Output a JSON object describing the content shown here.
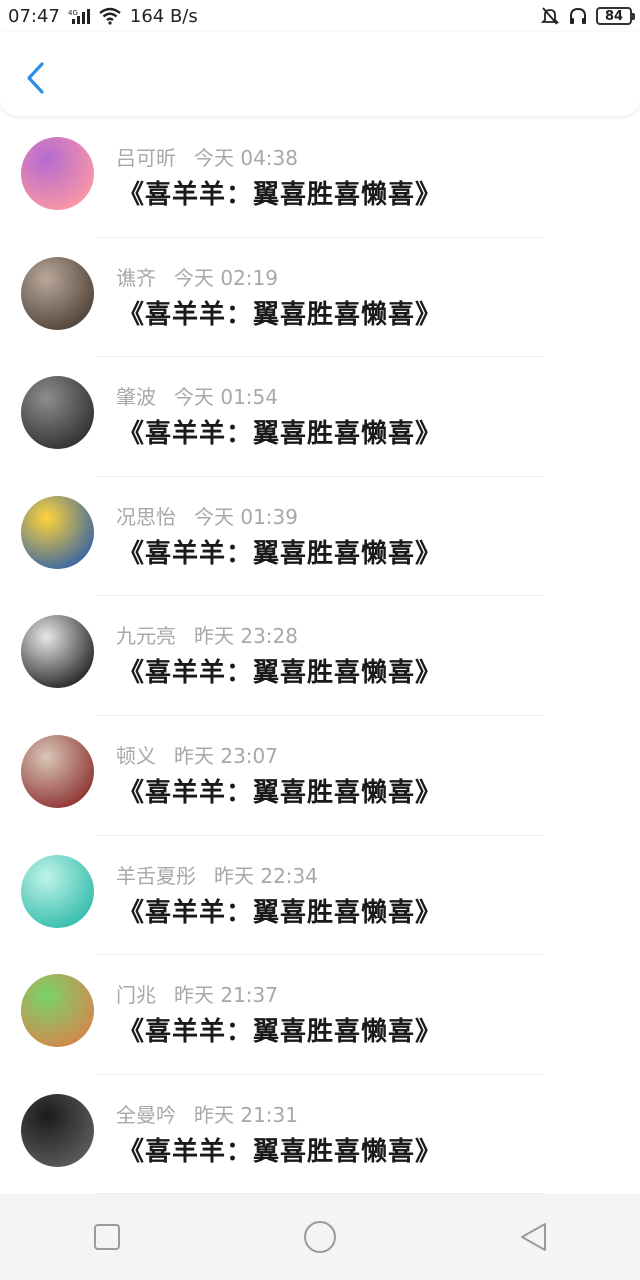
{
  "status_bar": {
    "time": "07:47",
    "network": "4G",
    "speed": "164 B/s",
    "battery": "84"
  },
  "header": {
    "back_icon": "chevron-left-icon"
  },
  "messages": [
    {
      "name": "吕可昕",
      "time": "今天 04:38",
      "text": "《喜羊羊：翼喜胜喜懒喜》",
      "avatar_colors": [
        "#b46ad1",
        "#ff9aa2"
      ]
    },
    {
      "name": "谯齐",
      "time": "今天 02:19",
      "text": "《喜羊羊：翼喜胜喜懒喜》",
      "avatar_colors": [
        "#b9a89a",
        "#4a3c33"
      ]
    },
    {
      "name": "肇波",
      "time": "今天 01:54",
      "text": "《喜羊羊：翼喜胜喜懒喜》",
      "avatar_colors": [
        "#8d8d8d",
        "#2b2b2b"
      ]
    },
    {
      "name": "况思怡",
      "time": "今天 01:39",
      "text": "《喜羊羊：翼喜胜喜懒喜》",
      "avatar_colors": [
        "#ffd43b",
        "#2d5ea8"
      ]
    },
    {
      "name": "九元亮",
      "time": "昨天 23:28",
      "text": "《喜羊羊：翼喜胜喜懒喜》",
      "avatar_colors": [
        "#e8e8e8",
        "#1a1a1a"
      ]
    },
    {
      "name": "顿义",
      "time": "昨天 23:07",
      "text": "《喜羊羊：翼喜胜喜懒喜》",
      "avatar_colors": [
        "#d8c7b7",
        "#8a2b2b"
      ]
    },
    {
      "name": "羊舌夏彤",
      "time": "昨天 22:34",
      "text": "《喜羊羊：翼喜胜喜懒喜》",
      "avatar_colors": [
        "#bff3e9",
        "#2cb9a8"
      ]
    },
    {
      "name": "门兆",
      "time": "昨天 21:37",
      "text": "《喜羊羊：翼喜胜喜懒喜》",
      "avatar_colors": [
        "#7ad36a",
        "#d9824b"
      ]
    },
    {
      "name": "全曼吟",
      "time": "昨天 21:31",
      "text": "《喜羊羊：翼喜胜喜懒喜》",
      "avatar_colors": [
        "#1b1b1b",
        "#606060"
      ]
    }
  ],
  "nav": {
    "recents_icon": "square-icon",
    "home_icon": "circle-icon",
    "back_icon": "triangle-back-icon"
  },
  "colors": {
    "accent": "#2b8fe8",
    "meta_text": "#a8a8a8",
    "message_text": "#1a1a1a"
  }
}
